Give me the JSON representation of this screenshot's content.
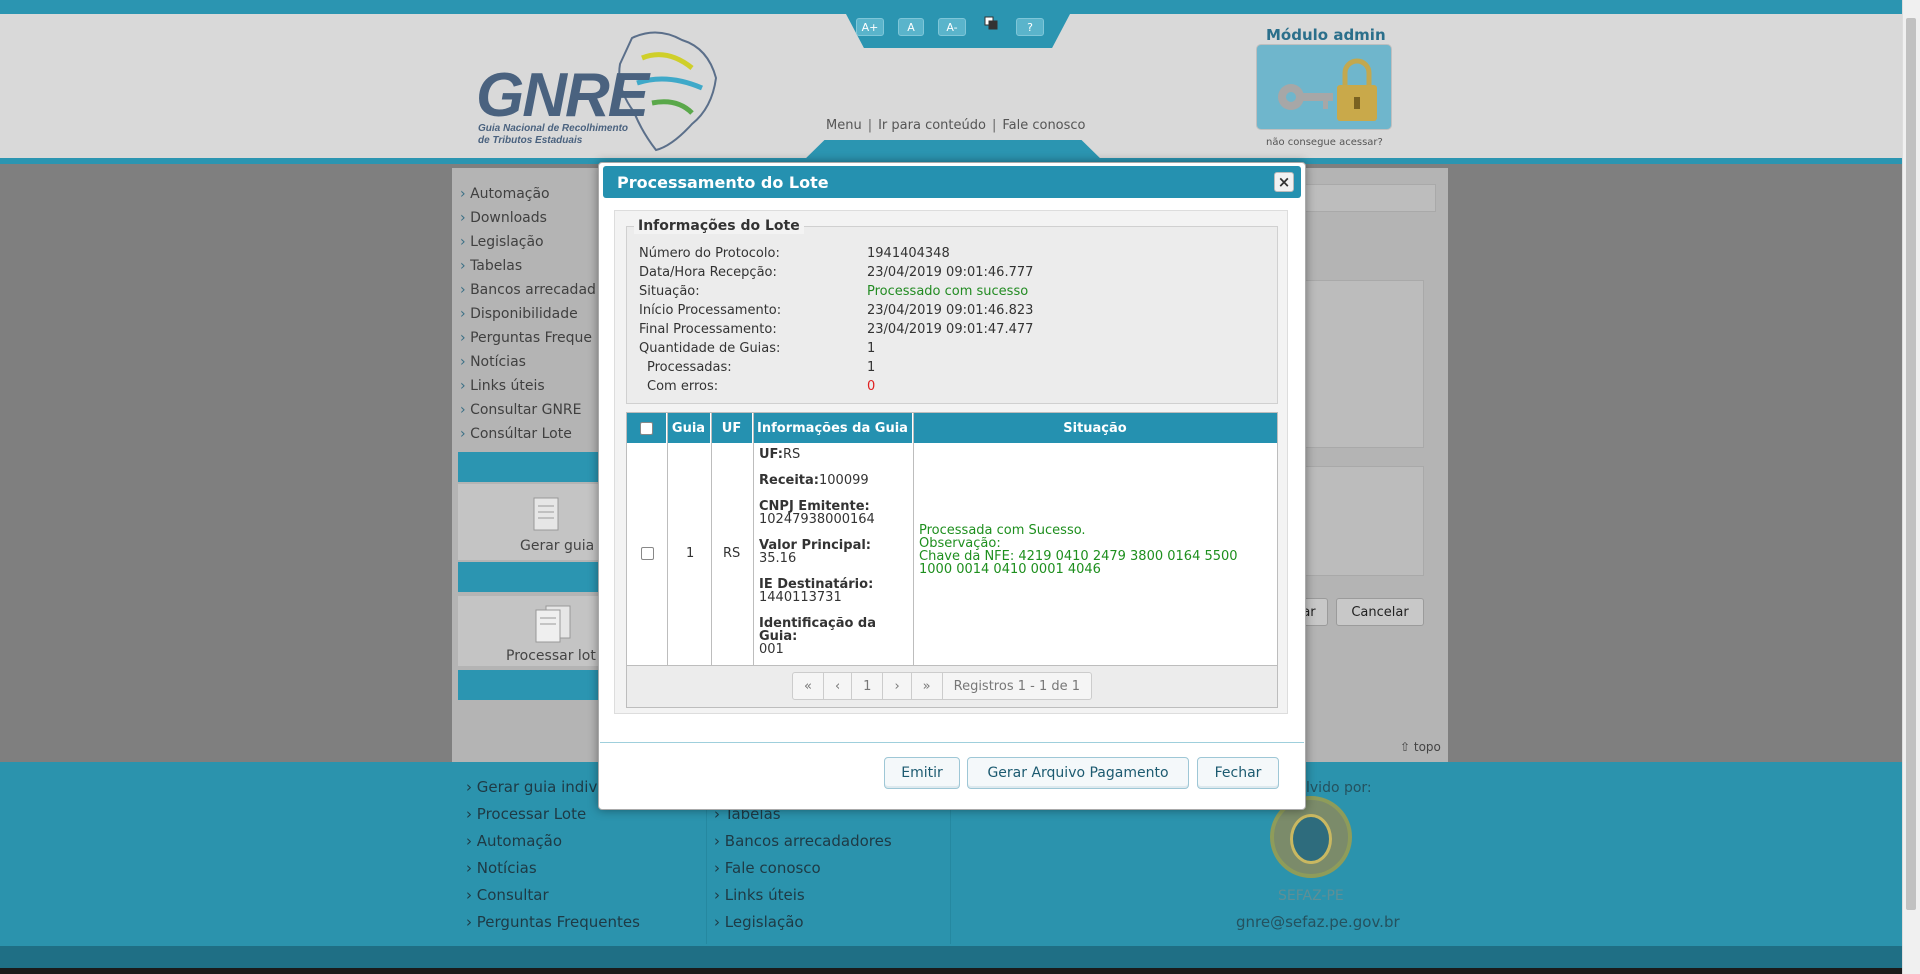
{
  "accessibility": {
    "buttons": [
      "A+",
      "A",
      "A-",
      "?"
    ]
  },
  "header": {
    "logo_title": "GNRE",
    "logo_subtitle_1": "Guia Nacional de Recolhimento",
    "logo_subtitle_2": "de Tributos Estaduais",
    "links": [
      "Menu",
      "Ir para conteúdo",
      "Fale conosco"
    ],
    "admin_title": "Módulo admin",
    "admin_help": "não consegue acessar?"
  },
  "sidebar": {
    "items": [
      "Automação",
      "Downloads",
      "Legislação",
      "Tabelas",
      "Bancos arrecadad",
      "Disponibilidade",
      "Perguntas Freque",
      "Notícias",
      "Links úteis",
      "Consultar GNRE",
      "Consúltar Lote"
    ],
    "card1_label": "Gerar guia",
    "card2_label": "Processar lot"
  },
  "background_buttons": {
    "confirm_partial": "ar",
    "cancel": "Cancelar"
  },
  "topo_label": "topo",
  "footer": {
    "col1": [
      "Gerar guia indiv",
      "Processar Lote",
      "Automação",
      "Notícias",
      "Consultar",
      "Perguntas Frequentes"
    ],
    "col2": [
      "Tabelas",
      "Bancos arrecadadores",
      "Fale conosco",
      "Links úteis",
      "Legislação"
    ],
    "developed_by": "lvido por:",
    "org": "SEFAZ-PE",
    "email": "gnre@sefaz.pe.gov.br"
  },
  "modal": {
    "title": "Processamento do Lote",
    "close_symbol": "×",
    "lote": {
      "legend": "Informações do Lote",
      "rows": [
        {
          "label": "Número do Protocolo:",
          "value": "1941404348"
        },
        {
          "label": "Data/Hora Recepção:",
          "value": "23/04/2019 09:01:46.777"
        },
        {
          "label": "Situação:",
          "value": "Processado com sucesso"
        },
        {
          "label": "Início Processamento:",
          "value": "23/04/2019 09:01:46.823"
        },
        {
          "label": "Final Processamento:",
          "value": "23/04/2019 09:01:47.477"
        },
        {
          "label": "Quantidade de Guias:",
          "value": "1"
        },
        {
          "label": "Processadas:",
          "value": "1"
        },
        {
          "label": "Com erros:",
          "value": "0"
        }
      ]
    },
    "table": {
      "headers": {
        "guia": "Guia",
        "uf": "UF",
        "info": "Informações da Guia",
        "situacao": "Situação"
      },
      "row": {
        "guia": "1",
        "uf": "RS",
        "info": {
          "uf_label": "UF:",
          "uf_value": "RS",
          "receita_label": "Receita:",
          "receita_value": "100099",
          "cnpj_label": "CNPJ Emitente:",
          "cnpj_value": "10247938000164",
          "valor_label": "Valor Principal:",
          "valor_value": "35.16",
          "ie_label": "IE Destinatário:",
          "ie_value": "1440113731",
          "ident_label": "Identificação da Guia:",
          "ident_value": "001"
        },
        "situacao_lines": [
          "Processada com Sucesso.",
          "Observação:",
          "Chave da NFE: 4219 0410 2479 3800 0164 5500",
          "1000 0014 0410 0001 4046"
        ]
      }
    },
    "pager": {
      "first": "«",
      "prev": "‹",
      "page": "1",
      "next": "›",
      "last": "»",
      "records": "Registros 1 - 1 de 1"
    },
    "buttons": {
      "emitir": "Emitir",
      "gerar": "Gerar Arquivo Pagamento",
      "fechar": "Fechar"
    }
  }
}
